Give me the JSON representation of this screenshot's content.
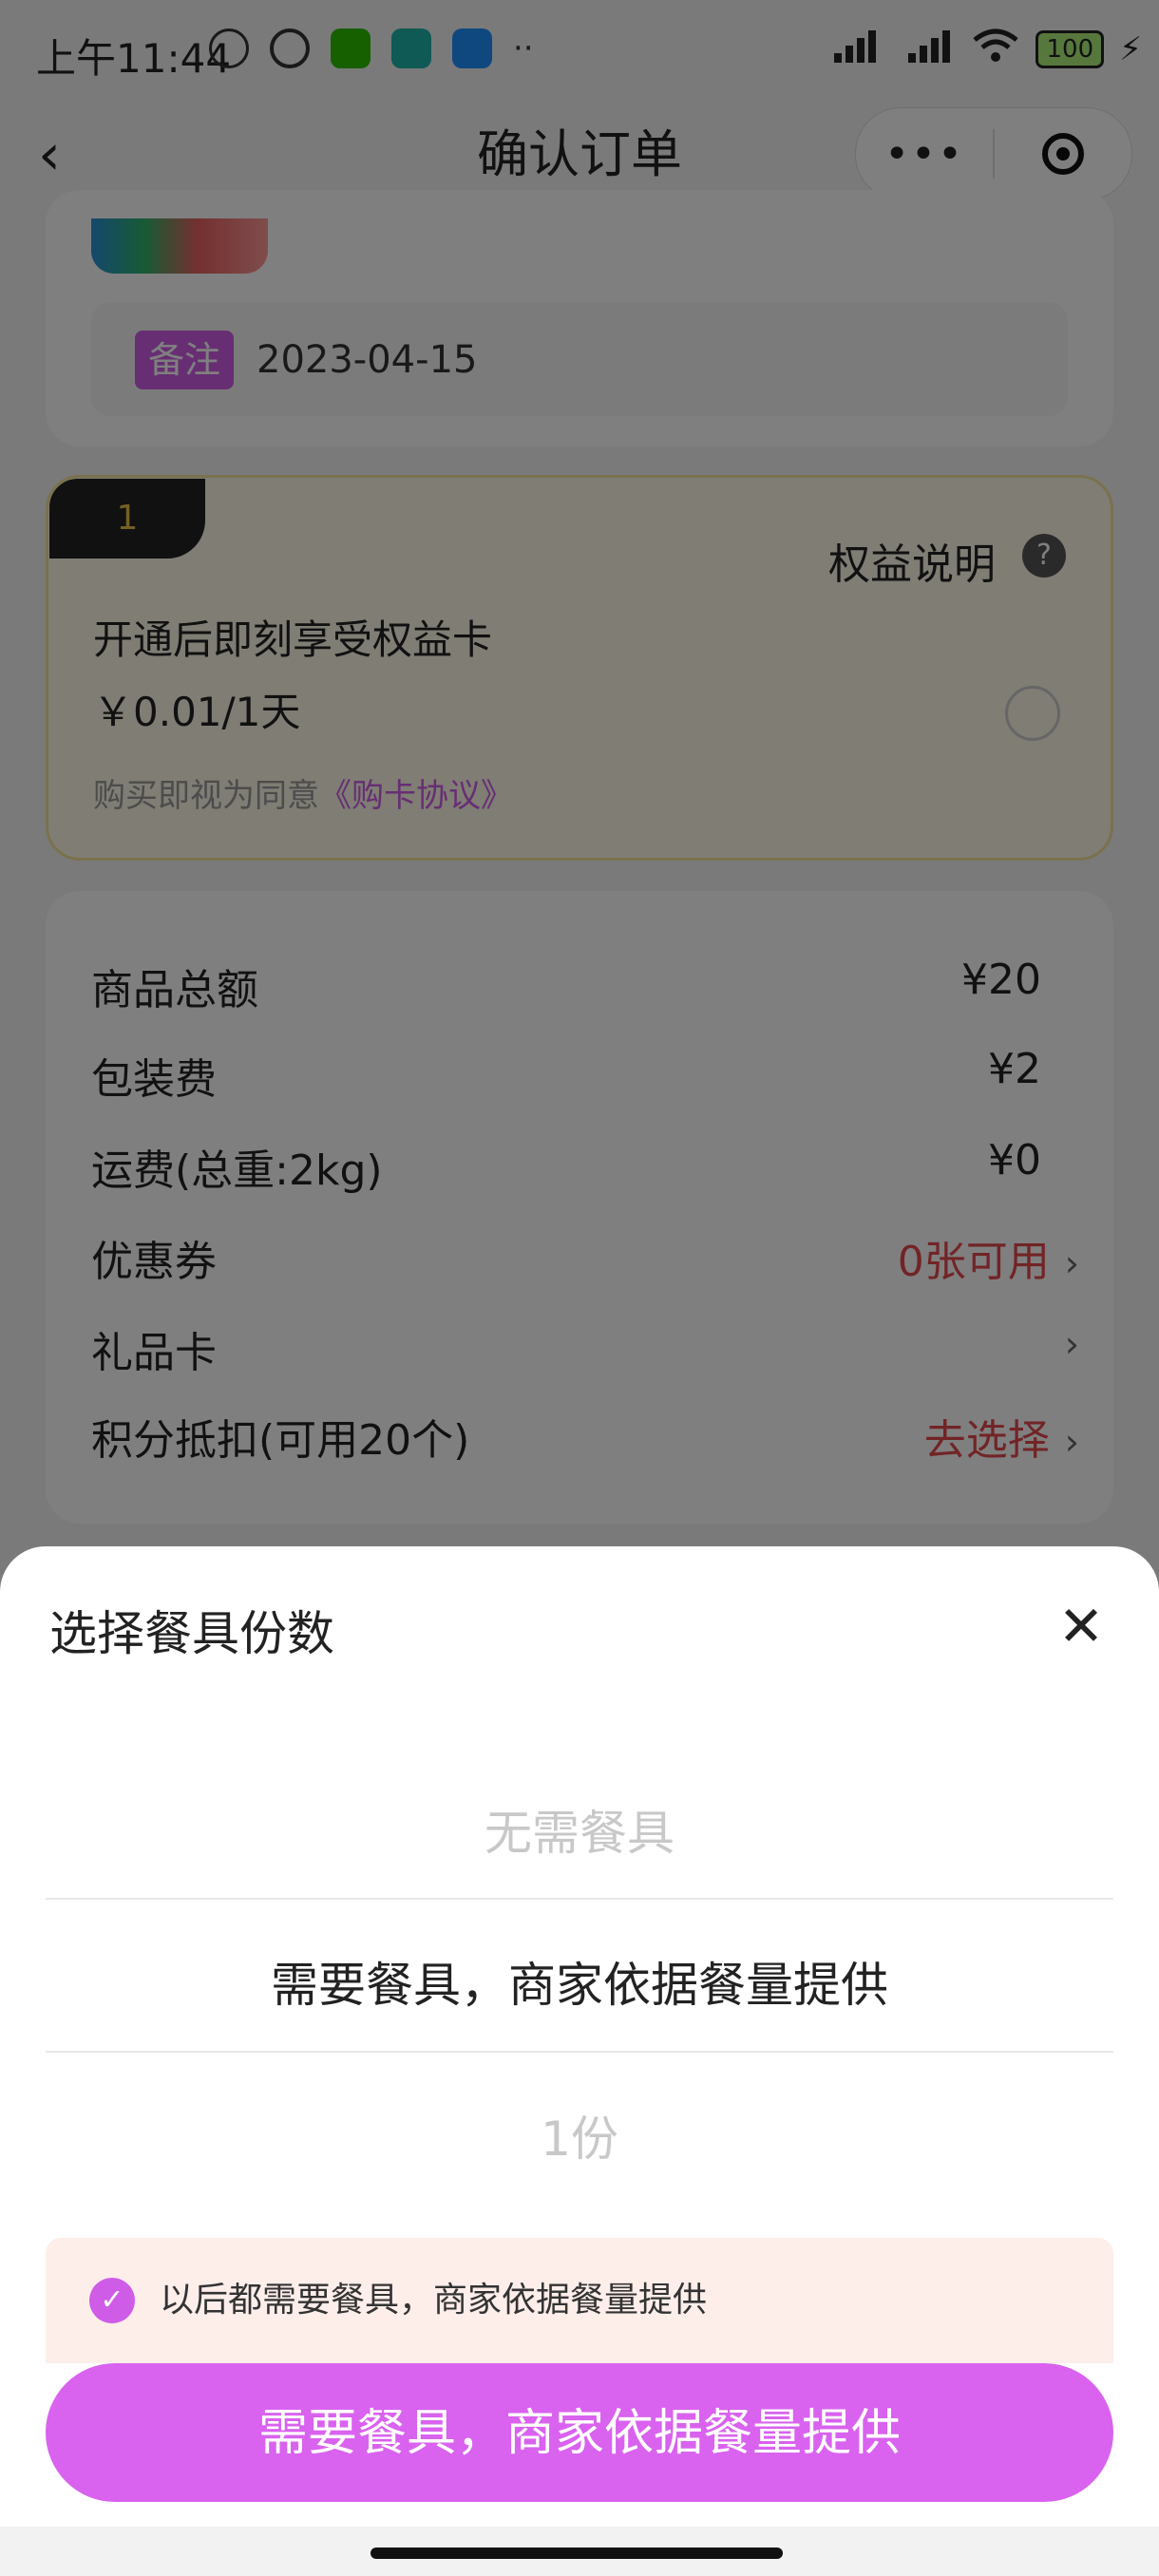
{
  "status_bar": {
    "time": "上午11:44",
    "right_icons": [
      "hd-signal-icon",
      "hd-signal-icon",
      "wifi-icon",
      "battery-icon",
      "charging-icon"
    ],
    "battery": "100",
    "left_icons": [
      "mute-icon",
      "alarm-icon",
      "wechat-icon",
      "boss-app-icon",
      "chat-app-icon"
    ],
    "left_more": "··"
  },
  "nav": {
    "title": "确认订单",
    "back": "‹",
    "more": "•••"
  },
  "order_item": {
    "note_badge": "备注",
    "note_date": "2023-04-15"
  },
  "membership": {
    "tab_label": "1",
    "rights_label": "权益说明",
    "help": "?",
    "title": "开通后即刻享受权益卡",
    "price": "￥0.01/1天",
    "agree_prefix": "购买即视为同意",
    "agree_link": "《购卡协议》"
  },
  "summary": {
    "rows": [
      {
        "label": "商品总额",
        "value": "¥20"
      },
      {
        "label": "包装费",
        "value": "¥2"
      },
      {
        "label": "运费(总重:2kg)",
        "value": "¥0"
      },
      {
        "label": "优惠券",
        "value": "0张可用"
      },
      {
        "label": "礼品卡",
        "value": ""
      },
      {
        "label": "积分抵扣(可用20个)",
        "value": "去选择"
      }
    ],
    "chevron": "›"
  },
  "tableware_sheet": {
    "title": "选择餐具份数",
    "close": "✕",
    "options": [
      "无需餐具",
      "需要餐具，商家依据餐量提供",
      "1份"
    ],
    "remember": "以后都需要餐具，商家依据餐量提供",
    "check": "✓",
    "confirm": "需要餐具，商家依据餐量提供"
  },
  "colors": {
    "accent": "#d962ef",
    "badge": "#cf5ce6",
    "red": "#e5484d"
  }
}
